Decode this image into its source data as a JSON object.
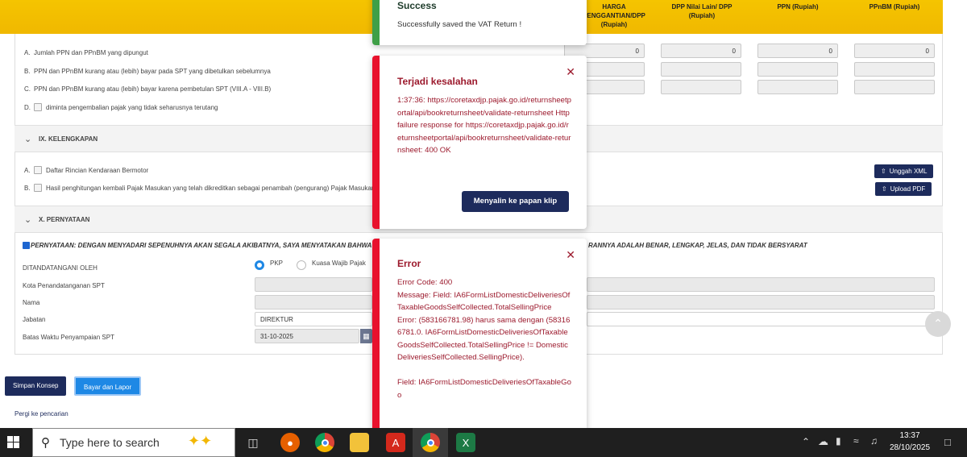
{
  "table_headers": {
    "harga": "HARGA PENGGANTIAN/DPP (Rupiah)",
    "dpp_lain": "DPP Nilai Lain/ DPP (Rupiah)",
    "ppn": "PPN (Rupiah)",
    "ppnbm": "PPnBM (Rupiah)"
  },
  "rows": {
    "a": {
      "letter": "A.",
      "text": "Jumlah PPN dan PPnBM yang dipungut",
      "values": [
        "0",
        "0",
        "0",
        "0"
      ]
    },
    "b": {
      "letter": "B.",
      "text": "PPN dan PPnBM kurang atau (lebih) bayar pada SPT yang dibetulkan sebelumnya"
    },
    "c": {
      "letter": "C.",
      "text": "PPN dan PPnBM kurang atau (lebih) bayar karena pembetulan SPT (VIII.A - VIII.B)"
    },
    "d": {
      "letter": "D.",
      "text": "diminta pengembalian pajak yang tidak seharusnya terutang"
    }
  },
  "section_ix": {
    "title": "IX. KELENGKAPAN",
    "item_a_letter": "A.",
    "item_a": "Daftar Rincian Kendaraan Bermotor",
    "item_b_letter": "B.",
    "item_b": "Hasil penghitungan kembali Pajak Masukan yang telah dikreditkan sebagai penambah (pengurang) Pajak Masukan",
    "upload_xml": "Unggah XML",
    "upload_pdf": "Upload PDF"
  },
  "section_x": {
    "title": "X. PERNYATAAN",
    "statement_left": "PERNYATAAN: DENGAN MENYADARI SEPENUHNYA AKAN SEGALA AKIBATNYA, SAYA MENYATAKAN BAHWA APA",
    "statement_right": "RANNYA ADALAH BENAR, LENGKAP, JELAS, DAN TIDAK BERSYARAT",
    "signed_by_label": "DITANDATANGANI OLEH",
    "radio_pkp": "PKP",
    "radio_kuasa": "Kuasa Wajib Pajak",
    "kota_label": "Kota Penandatanganan SPT",
    "nama_label": "Nama",
    "jabatan_label": "Jabatan",
    "jabatan_value": "DIREKTUR",
    "batas_label": "Batas Waktu Penyampaian SPT",
    "batas_value": "31-10-2025"
  },
  "buttons": {
    "simpan": "Simpan Konsep",
    "bayar": "Bayar dan Lapor",
    "pergi": "Pergi ke pencarian"
  },
  "toast_success": {
    "title": "Success",
    "message": "Successfully saved the VAT Return !",
    "color": "#3f9f47"
  },
  "toast_error1": {
    "title": "Terjadi kesalahan",
    "body": "1:37:36: https://coretaxdjp.pajak.go.id/returnsheetportal/api/bookreturnsheet/validate-returnsheet Http failure response for https://coretaxdjp.pajak.go.id/returnsheetportal/api/bookreturnsheet/validate-returnsheet: 400 OK",
    "copy_button": "Menyalin ke papan klip",
    "color": "#e8112d"
  },
  "toast_error2": {
    "title": "Error",
    "body_lines": [
      "Error Code: 400",
      "Message: Field: IA6FormListDomesticDeliveriesOfTaxableGoodsSelfCollected.TotalSellingPrice",
      "Error: (583166781.98) harus sama dengan (583166781.0. IA6FormListDomesticDeliveriesOfTaxableGoodsSelfCollected.TotalSellingPrice != DomesticDeliveriesSelfCollected.SellingPrice).",
      "",
      "Field: IA6FormListDomesticDeliveriesOfTaxableGoo"
    ],
    "color": "#e8112d"
  },
  "taskbar": {
    "search_placeholder": "Type here to search",
    "time": "13:37",
    "date": "28/10/2025",
    "icons": [
      "windows-icon",
      "search-icon",
      "task-view-icon",
      "firefox-icon",
      "chrome-icon",
      "file-explorer-icon",
      "acrobat-icon",
      "chrome-profile-icon",
      "excel-icon"
    ]
  },
  "colors": {
    "header_yellow": "#f5c400",
    "navy": "#1d2b5c",
    "primary_blue": "#1e88e5"
  }
}
